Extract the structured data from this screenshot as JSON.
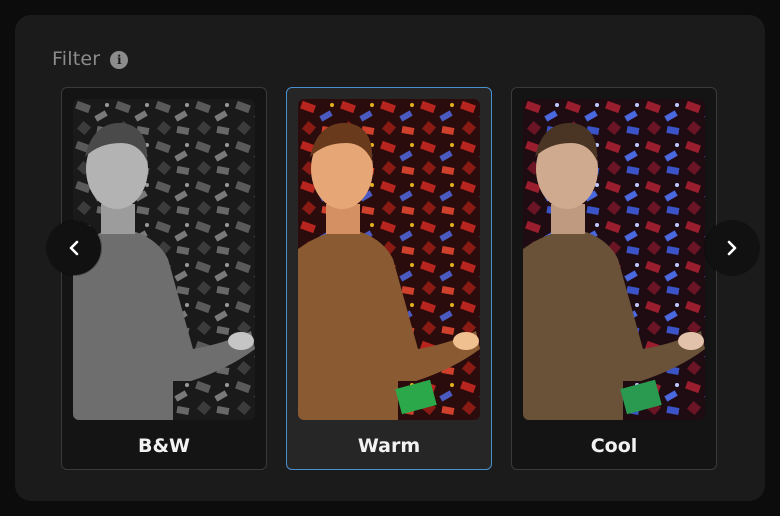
{
  "filter_panel": {
    "title": "Filter",
    "info_icon": "info-icon",
    "selected": "Warm",
    "options": [
      {
        "label": "B&W",
        "variant": "bw"
      },
      {
        "label": "Warm",
        "variant": "warm"
      },
      {
        "label": "Cool",
        "variant": "cool"
      }
    ]
  },
  "navigation": {
    "prev_icon": "chevron-left-icon",
    "next_icon": "chevron-right-icon"
  },
  "colors": {
    "panel_background": "#1b1b1b",
    "selected_border": "#4a8fd0",
    "card_border": "#3a3a3a"
  }
}
